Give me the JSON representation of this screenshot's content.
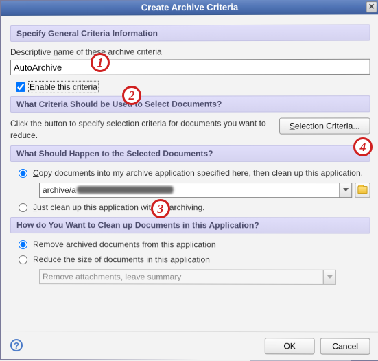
{
  "window": {
    "title": "Create Archive Criteria"
  },
  "sections": {
    "general": "Specify General Criteria Information",
    "criteria": "What Criteria Should be Used to Select Documents?",
    "action": "What Should Happen to the Selected Documents?",
    "cleanup": "How do You Want to Clean up Documents in this Application?"
  },
  "general": {
    "name_label": "Descriptive name of these archive criteria",
    "name_value": "AutoArchive",
    "enable_label": "Enable this criteria",
    "enable_checked": true
  },
  "criteria": {
    "desc": "Click the button to specify selection criteria for documents you want to reduce.",
    "button": "Selection Criteria..."
  },
  "action": {
    "radio_copy": "Copy documents into my archive application specified here, then clean up this application.",
    "archive_path_prefix": "archive/a",
    "radio_just_clean": "Just clean up this application without archiving."
  },
  "cleanup": {
    "radio_remove": "Remove archived documents from this application",
    "radio_reduce": "Reduce the size of documents in this application",
    "reduce_option": "Remove attachments, leave summary"
  },
  "footer": {
    "ok": "OK",
    "cancel": "Cancel"
  },
  "callouts": {
    "c1": "1",
    "c2": "2",
    "c3": "3",
    "c4": "4"
  }
}
